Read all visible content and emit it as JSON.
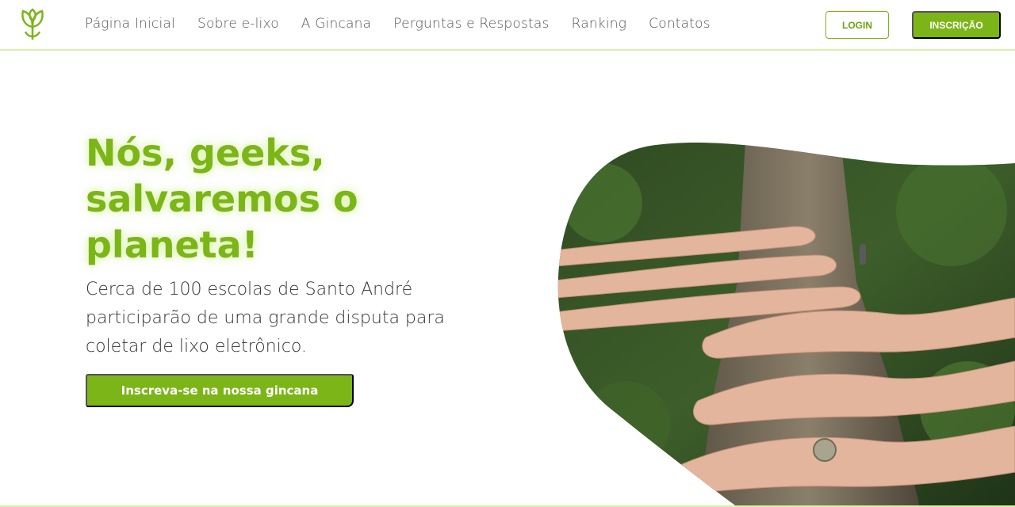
{
  "nav": {
    "logo": "leaf-logo-icon",
    "links": [
      "Página Inicial",
      "Sobre e-lixo",
      "A Gincana",
      "Perguntas e Respostas",
      "Ranking",
      "Contatos"
    ],
    "login_label": "LOGIN",
    "signup_label": "INSCRIÇÃO"
  },
  "hero": {
    "title_lines": [
      "Nós, geeks,",
      "salvaremos o",
      "planeta!"
    ],
    "text_lines": [
      "Cerca de 100 escolas de Santo André",
      "participarão de uma grande disputa para",
      "coletar de lixo eletrônico."
    ],
    "cta_label": "Inscreva-se na nossa gincana",
    "image": "hands-on-tree-trunk-photo"
  },
  "colors": {
    "accent": "#7cb518",
    "accent_light": "#d8f0a8",
    "text": "#333333"
  }
}
